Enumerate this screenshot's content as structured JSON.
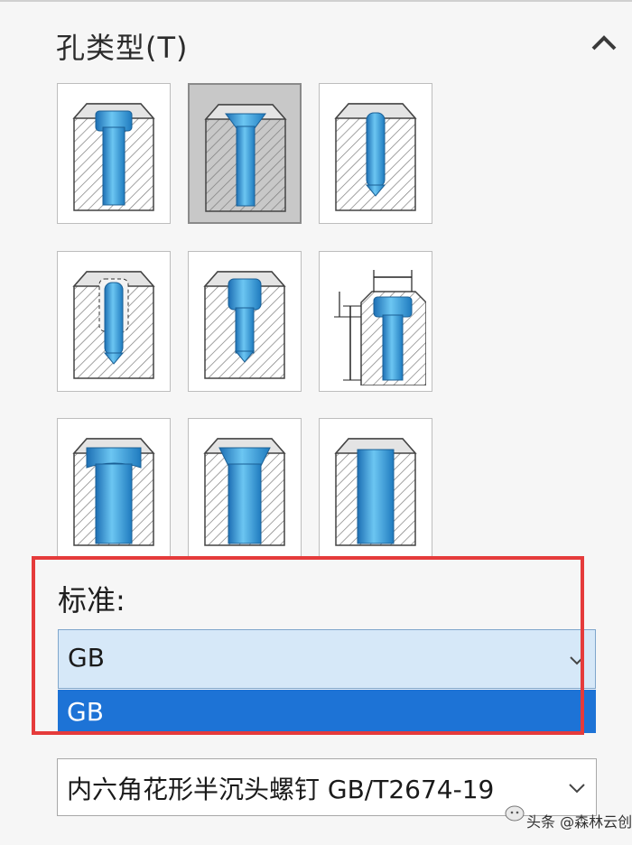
{
  "section": {
    "title": "孔类型(T)"
  },
  "hole_types": [
    {
      "name": "counterbore",
      "selected": false
    },
    {
      "name": "countersink",
      "selected": true
    },
    {
      "name": "hole",
      "selected": false
    },
    {
      "name": "straight-tap",
      "selected": false
    },
    {
      "name": "tapered-tap",
      "selected": false
    },
    {
      "name": "legacy-hole",
      "selected": false
    },
    {
      "name": "counterbore-slot",
      "selected": false
    },
    {
      "name": "countersink-slot",
      "selected": false
    },
    {
      "name": "slot",
      "selected": false
    }
  ],
  "standard": {
    "label": "标准:",
    "value": "GB",
    "options": [
      "GB"
    ]
  },
  "type_select": {
    "value": "内六角花形半沉头螺钉 GB/T2674-19"
  },
  "watermark": {
    "text": "头条 @森林云创"
  },
  "colors": {
    "highlight_frame": "#e53b3b",
    "option_selected": "#1d73d6",
    "hole_blue": "#3ea0dc"
  }
}
